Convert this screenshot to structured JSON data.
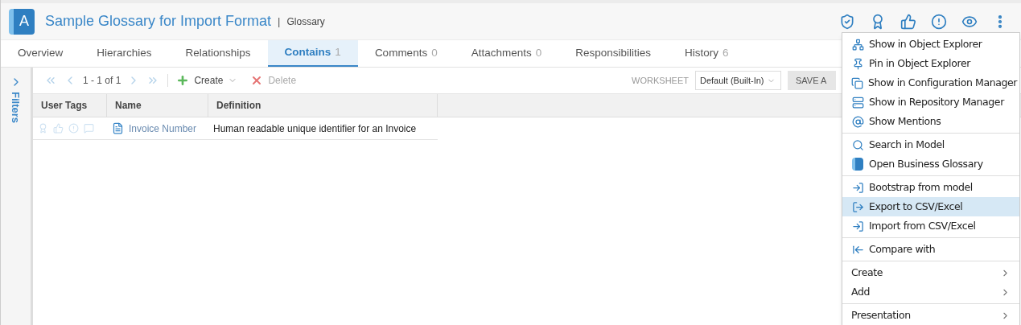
{
  "header": {
    "logo": "A",
    "title": "Sample Glossary for Import Format",
    "separator": "|",
    "type": "Glossary"
  },
  "tabs": [
    {
      "label": "Overview",
      "selected": false
    },
    {
      "label": "Hierarchies",
      "selected": false
    },
    {
      "label": "Relationships",
      "selected": false
    },
    {
      "label": "Contains",
      "count": "1",
      "selected": true
    },
    {
      "label": "Comments",
      "count": "0",
      "selected": false
    },
    {
      "label": "Attachments",
      "count": "0",
      "selected": false
    },
    {
      "label": "Responsibilities",
      "selected": false
    },
    {
      "label": "History",
      "count": "6",
      "selected": false
    }
  ],
  "filters": {
    "label": "Filters"
  },
  "toolbar": {
    "pager": "1 - 1 of 1",
    "create": "Create",
    "delete": "Delete",
    "worksheet_label": "WORKSHEET",
    "worksheet": "Default (Built-In)",
    "save": "SAVE A"
  },
  "table": {
    "columns": [
      "User Tags",
      "Name",
      "Definition"
    ],
    "rows": [
      {
        "name": "Invoice Number",
        "definition": "Human readable unique identifier for an Invoice"
      }
    ]
  },
  "menu": {
    "groups": [
      [
        {
          "kind": "item",
          "label": "Show in Object Explorer",
          "selected": false
        },
        {
          "kind": "item",
          "label": "Pin in Object Explorer",
          "selected": false
        },
        {
          "kind": "item",
          "label": "Show in Configuration Manager",
          "selected": false
        },
        {
          "kind": "item",
          "label": "Show in Repository Manager",
          "selected": false
        },
        {
          "kind": "item",
          "label": "Show Mentions",
          "selected": false
        }
      ],
      [
        {
          "kind": "item",
          "label": "Search in Model",
          "selected": false
        },
        {
          "kind": "item",
          "label": "Open Business Glossary",
          "selected": false
        }
      ],
      [
        {
          "kind": "item",
          "label": "Bootstrap from model",
          "selected": false
        },
        {
          "kind": "item",
          "label": "Export to CSV/Excel",
          "selected": true
        },
        {
          "kind": "item",
          "label": "Import from CSV/Excel",
          "selected": false
        }
      ],
      [
        {
          "kind": "item",
          "label": "Compare with",
          "selected": false
        }
      ],
      [
        {
          "kind": "submenu",
          "label": "Create",
          "selected": false
        },
        {
          "kind": "submenu",
          "label": "Add",
          "selected": false
        }
      ],
      [
        {
          "kind": "submenu",
          "label": "Presentation",
          "selected": false
        }
      ]
    ]
  }
}
